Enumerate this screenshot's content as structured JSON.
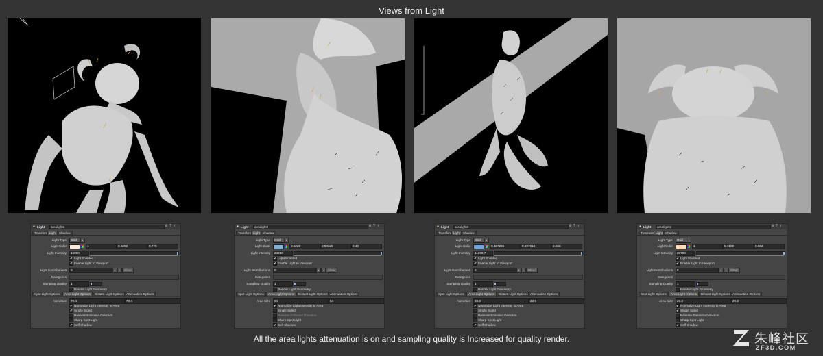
{
  "page": {
    "title": "Views from Light",
    "caption": "All the area lights attenuation is on and sampling quality is Increased for quality render."
  },
  "watermark": {
    "chinese": "朱峰社区",
    "domain": "ZF3D.COM"
  },
  "common": {
    "type_label": "Light",
    "tabs": [
      "Transform",
      "Light",
      "Shadow"
    ],
    "light_type_label": "Light Type",
    "light_type_value": "Grid",
    "light_color_label": "Light Color",
    "light_intensity_label": "Light Intensity",
    "light_enabled": "Light Enabled",
    "enable_viewport": "Enable Light In Viewport",
    "light_contributions": "Light Contributions",
    "contrib_value": "0",
    "clear": "Clear",
    "categories": "Categories",
    "sampling_quality": "Sampling Quality",
    "sampling_value": "1",
    "render_geometry": "Render Light Geometry",
    "subtabs": [
      "Spot Light Options",
      "Area Light Options",
      "Distant Light Options",
      "Attenuation Options"
    ],
    "area_size": "Area Size",
    "opts": [
      "Normalize Light Intensity to Area",
      "Single Sided",
      "Reverse Emission Direction",
      "Sharp Spot Light",
      "Self Shadow"
    ]
  },
  "panels": [
    {
      "name": "arealight1",
      "color": [
        "1",
        "0.8298",
        "0.778"
      ],
      "swatch": "#ffe9dc",
      "intensity": "15000",
      "area": [
        "70.4",
        "70.4"
      ],
      "opts_checked": [
        true,
        true,
        false,
        false,
        true
      ],
      "opts_dim": [
        false,
        false,
        false,
        false,
        false
      ]
    },
    {
      "name": "arealight2",
      "color": [
        "0.5225",
        "0.50625",
        "0.49"
      ],
      "swatch": "#7fb0d8",
      "intensity": "24250",
      "area": [
        "64",
        "64"
      ],
      "opts_checked": [
        true,
        false,
        false,
        false,
        true
      ],
      "opts_dim": [
        false,
        false,
        true,
        false,
        false
      ]
    },
    {
      "name": "arealight3",
      "color": [
        "0.327236",
        "0.597618",
        "0.868"
      ],
      "swatch": "#6fa8de",
      "intensity": "11299.7",
      "area": [
        "23.9",
        "23.9"
      ],
      "opts_checked": [
        true,
        false,
        false,
        false,
        true
      ],
      "opts_dim": [
        false,
        false,
        false,
        false,
        false
      ]
    },
    {
      "name": "arealight4",
      "color": [
        "1",
        "0.7169",
        "0.553"
      ],
      "swatch": "#ffd8b4",
      "intensity": "20700",
      "area": [
        "29.2",
        "29.2"
      ],
      "opts_checked": [
        true,
        true,
        false,
        false,
        true
      ],
      "opts_dim": [
        false,
        false,
        false,
        false,
        false
      ]
    }
  ]
}
